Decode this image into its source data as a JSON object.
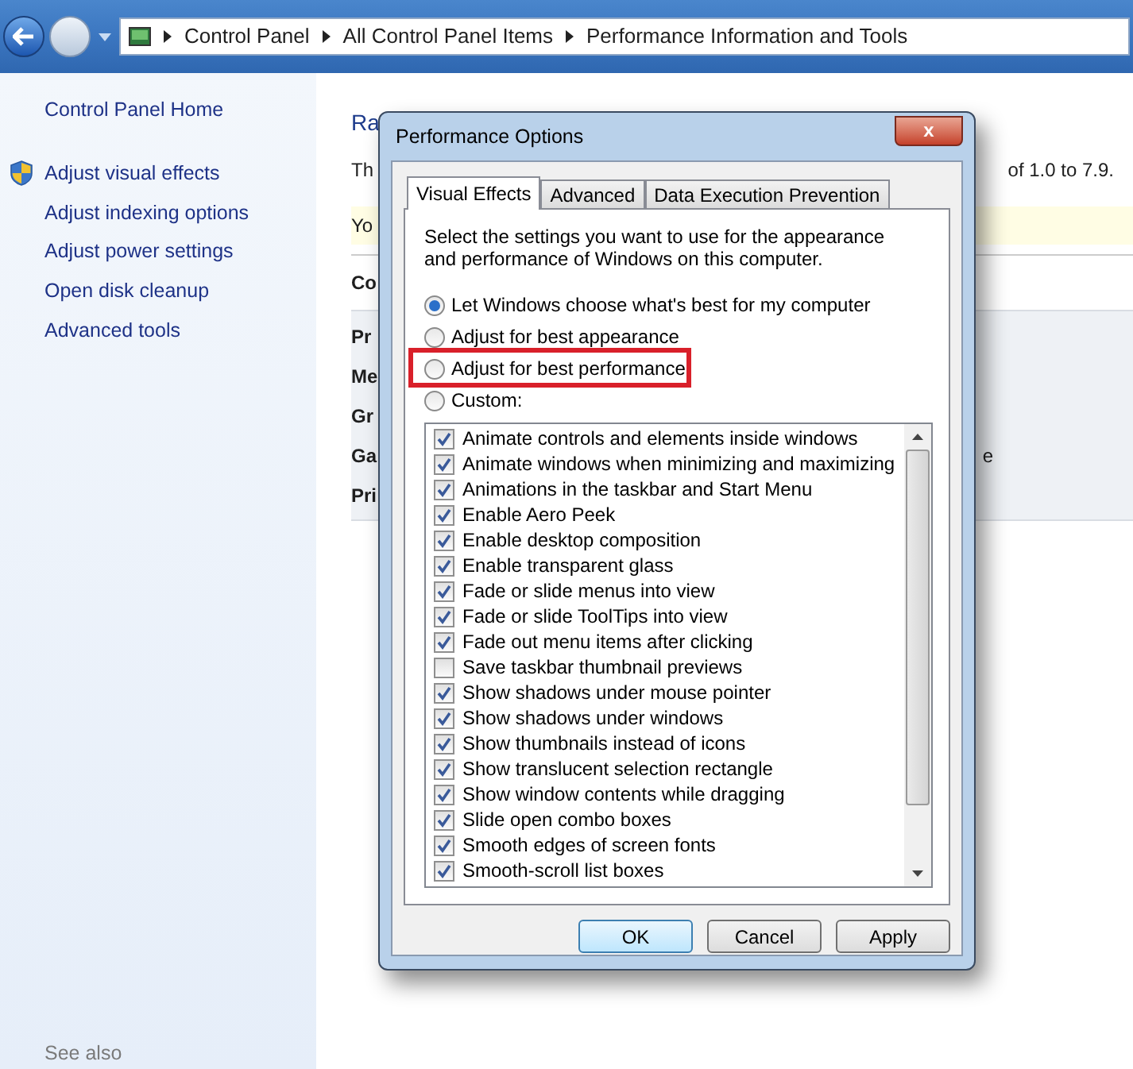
{
  "breadcrumbs": [
    "Control Panel",
    "All Control Panel Items",
    "Performance Information and Tools"
  ],
  "sidebar": {
    "home": "Control Panel Home",
    "items": [
      {
        "label": "Adjust visual effects",
        "kind": "shield"
      },
      {
        "label": "Adjust indexing options",
        "kind": "plain"
      },
      {
        "label": "Adjust power settings",
        "kind": "plain"
      },
      {
        "label": "Open disk cleanup",
        "kind": "plain"
      },
      {
        "label": "Advanced tools",
        "kind": "plain"
      }
    ],
    "see_also": "See also"
  },
  "main": {
    "heading": "Ra",
    "intro": "Th",
    "intro_end": "of 1.0 to 7.9.",
    "notice": "Yo",
    "section_label": "Co",
    "rows": [
      {
        "label": "Pr"
      },
      {
        "label": "Me"
      },
      {
        "label": "Gr"
      },
      {
        "label": "Ga",
        "trailing": "e"
      },
      {
        "label": "Pri"
      }
    ]
  },
  "dialog": {
    "title": "Performance Options",
    "close": "x",
    "tabs": [
      {
        "label": "Visual Effects",
        "selected": true
      },
      {
        "label": "Advanced",
        "selected": false
      },
      {
        "label": "Data Execution Prevention",
        "selected": false
      }
    ],
    "description": "Select the settings you want to use for the appearance and performance of Windows on this computer.",
    "options": [
      {
        "label": "Let Windows choose what's best for my computer",
        "selected": true,
        "highlighted": false
      },
      {
        "label": "Adjust for best appearance",
        "selected": false,
        "highlighted": false
      },
      {
        "label": "Adjust for best performance",
        "selected": false,
        "highlighted": true
      },
      {
        "label": "Custom:",
        "selected": false,
        "highlighted": false
      }
    ],
    "effects": [
      {
        "label": "Animate controls and elements inside windows",
        "checked": true
      },
      {
        "label": "Animate windows when minimizing and maximizing",
        "checked": true
      },
      {
        "label": "Animations in the taskbar and Start Menu",
        "checked": true
      },
      {
        "label": "Enable Aero Peek",
        "checked": true
      },
      {
        "label": "Enable desktop composition",
        "checked": true
      },
      {
        "label": "Enable transparent glass",
        "checked": true
      },
      {
        "label": "Fade or slide menus into view",
        "checked": true
      },
      {
        "label": "Fade or slide ToolTips into view",
        "checked": true
      },
      {
        "label": "Fade out menu items after clicking",
        "checked": true
      },
      {
        "label": "Save taskbar thumbnail previews",
        "checked": false
      },
      {
        "label": "Show shadows under mouse pointer",
        "checked": true
      },
      {
        "label": "Show shadows under windows",
        "checked": true
      },
      {
        "label": "Show thumbnails instead of icons",
        "checked": true
      },
      {
        "label": "Show translucent selection rectangle",
        "checked": true
      },
      {
        "label": "Show window contents while dragging",
        "checked": true
      },
      {
        "label": "Slide open combo boxes",
        "checked": true
      },
      {
        "label": "Smooth edges of screen fonts",
        "checked": true
      },
      {
        "label": "Smooth-scroll list boxes",
        "checked": true
      }
    ],
    "buttons": [
      {
        "label": "OK",
        "kind": "default"
      },
      {
        "label": "Cancel",
        "kind": "normal"
      },
      {
        "label": "Apply",
        "kind": "normal"
      }
    ]
  }
}
